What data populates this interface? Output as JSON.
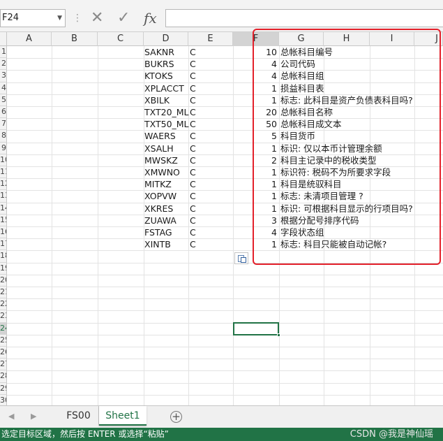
{
  "formula_bar": {
    "name_box": "F24",
    "cancel_symbol": "✕",
    "enter_symbol": "✓",
    "function_symbol": "fx",
    "formula": ""
  },
  "columns": [
    "A",
    "B",
    "C",
    "D",
    "E",
    "F",
    "G",
    "H",
    "I",
    "J"
  ],
  "rows": [
    "1",
    "2",
    "3",
    "4",
    "5",
    "6",
    "7",
    "8",
    "9",
    "10",
    "11",
    "12",
    "13",
    "14",
    "15",
    "16",
    "17",
    "18",
    "19",
    "20",
    "21",
    "22",
    "23",
    "24",
    "25",
    "26",
    "27",
    "28",
    "29",
    "30"
  ],
  "table": [
    {
      "field": "SAKNR",
      "type": "C",
      "length": "10",
      "description": "总帐科目编号"
    },
    {
      "field": "BUKRS",
      "type": "C",
      "length": "4",
      "description": "公司代码"
    },
    {
      "field": "KTOKS",
      "type": "C",
      "length": "4",
      "description": "总帐科目组"
    },
    {
      "field": "XPLACCT",
      "type": "C",
      "length": "1",
      "description": "损益科目表"
    },
    {
      "field": "XBILK",
      "type": "C",
      "length": "1",
      "description": "标志: 此科目是资产负债表科目吗?"
    },
    {
      "field": "TXT20_ML",
      "type": "C",
      "length": "20",
      "description": "总帐科目名称"
    },
    {
      "field": "TXT50_ML",
      "type": "C",
      "length": "50",
      "description": "总帐科目成文本"
    },
    {
      "field": "WAERS",
      "type": "C",
      "length": "5",
      "description": "科目货币"
    },
    {
      "field": "XSALH",
      "type": "C",
      "length": "1",
      "description": "标识: 仅以本币计管理余额"
    },
    {
      "field": "MWSKZ",
      "type": "C",
      "length": "2",
      "description": "科目主记录中的税收类型"
    },
    {
      "field": "XMWNO",
      "type": "C",
      "length": "1",
      "description": "标识符: 税码不为所要求字段"
    },
    {
      "field": "MITKZ",
      "type": "C",
      "length": "1",
      "description": "科目是统驭科目"
    },
    {
      "field": "XOPVW",
      "type": "C",
      "length": "1",
      "description": "标志: 未清项目管理 ?"
    },
    {
      "field": "XKRES",
      "type": "C",
      "length": "1",
      "description": "标识: 可根据科目显示的行项目吗?"
    },
    {
      "field": "ZUAWA",
      "type": "C",
      "length": "3",
      "description": "根据分配号排序代码"
    },
    {
      "field": "FSTAG",
      "type": "C",
      "length": "4",
      "description": "字段状态组"
    },
    {
      "field": "XINTB",
      "type": "C",
      "length": "1",
      "description": "标志: 科目只能被自动记帐?"
    }
  ],
  "sheet_tabs": {
    "prev": "◀",
    "next": "▶",
    "tabs": [
      "FS00",
      "Sheet1"
    ],
    "active": "Sheet1",
    "add": "+"
  },
  "status_bar": {
    "message": "选定目标区域，然后按 ENTER 或选择“粘贴”",
    "watermark": "CSDN @我是神仙瑶"
  },
  "colors": {
    "excel_green": "#217346",
    "highlight_box": "#e3202a"
  },
  "icons": [
    "cancel-icon",
    "enter-icon",
    "function-icon",
    "paste-options-icon",
    "add-sheet-icon"
  ]
}
